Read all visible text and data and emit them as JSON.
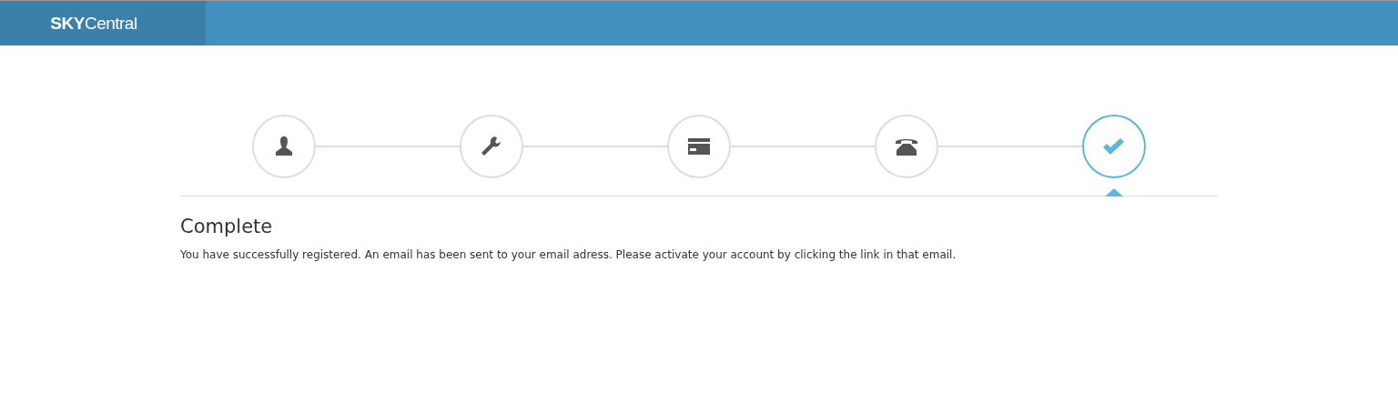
{
  "header": {
    "logo": "**SKY**Central"
  },
  "steps": [
    {
      "kind": "person",
      "selected": false
    },
    {
      "kind": "wrench",
      "selected": false
    },
    {
      "kind": "card",
      "selected": false
    },
    {
      "kind": "phone",
      "selected": false
    },
    {
      "kind": "check",
      "selected": true
    }
  ],
  "content": {
    "title": "Complete",
    "message": "You have successfully registered. An email has been sent to your email adress. Please activate your account by clicking the link in that email."
  }
}
